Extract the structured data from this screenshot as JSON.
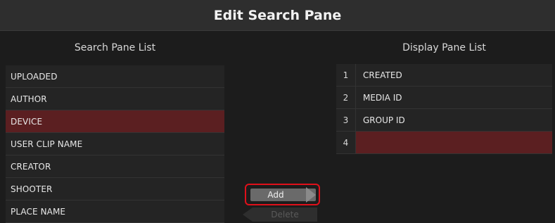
{
  "title": "Edit Search Pane",
  "search_pane": {
    "header": "Search Pane List",
    "items": [
      {
        "label": "UPLOADED",
        "selected": false
      },
      {
        "label": "AUTHOR",
        "selected": false
      },
      {
        "label": "DEVICE",
        "selected": true
      },
      {
        "label": "USER CLIP NAME",
        "selected": false
      },
      {
        "label": "CREATOR",
        "selected": false
      },
      {
        "label": "SHOOTER",
        "selected": false
      },
      {
        "label": "PLACE NAME",
        "selected": false
      }
    ]
  },
  "display_pane": {
    "header": "Display Pane List",
    "rows": [
      {
        "num": "1",
        "label": "CREATED",
        "selected": false
      },
      {
        "num": "2",
        "label": "MEDIA ID",
        "selected": false
      },
      {
        "num": "3",
        "label": "GROUP ID",
        "selected": false
      },
      {
        "num": "4",
        "label": "",
        "selected": true
      }
    ]
  },
  "buttons": {
    "add": "Add",
    "delete": "Delete"
  },
  "colors": {
    "selection": "#5b1f21",
    "highlight_outline": "#e0101a"
  }
}
